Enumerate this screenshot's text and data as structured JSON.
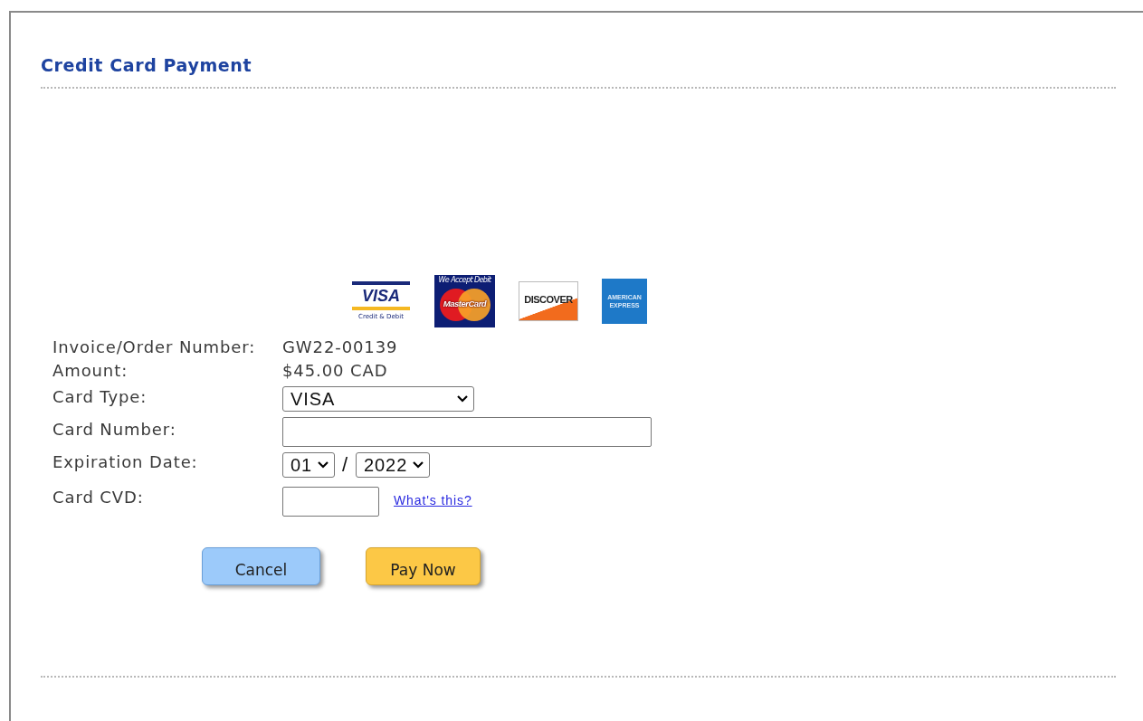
{
  "title": "Credit Card Payment",
  "card_logos": [
    {
      "kind": "visa",
      "text": "VISA",
      "subtext": "Credit & Debit"
    },
    {
      "kind": "mastercard",
      "text": "MasterCard",
      "subtext": "We Accept Debit"
    },
    {
      "kind": "discover",
      "text": "DISCOVER"
    },
    {
      "kind": "amex",
      "text": "AMERICAN EXPRESS"
    }
  ],
  "fields": [
    {
      "kind": "text",
      "label": "Invoice/Order Number:",
      "value": "GW22-00139"
    },
    {
      "kind": "text",
      "label": "Amount:",
      "value": "$45.00 CAD"
    },
    {
      "kind": "select",
      "label": "Card Type:",
      "value": "VISA"
    },
    {
      "kind": "input",
      "label": "Card Number:"
    },
    {
      "kind": "date",
      "label": "Expiration Date:",
      "month": "01",
      "separator": "/",
      "year": "2022"
    },
    {
      "kind": "cvd",
      "label": "Card CVD:",
      "link": "What's this?"
    }
  ],
  "buttons": [
    {
      "kind": "cancel",
      "label": "Cancel"
    },
    {
      "kind": "pay",
      "label": "Pay Now"
    }
  ]
}
